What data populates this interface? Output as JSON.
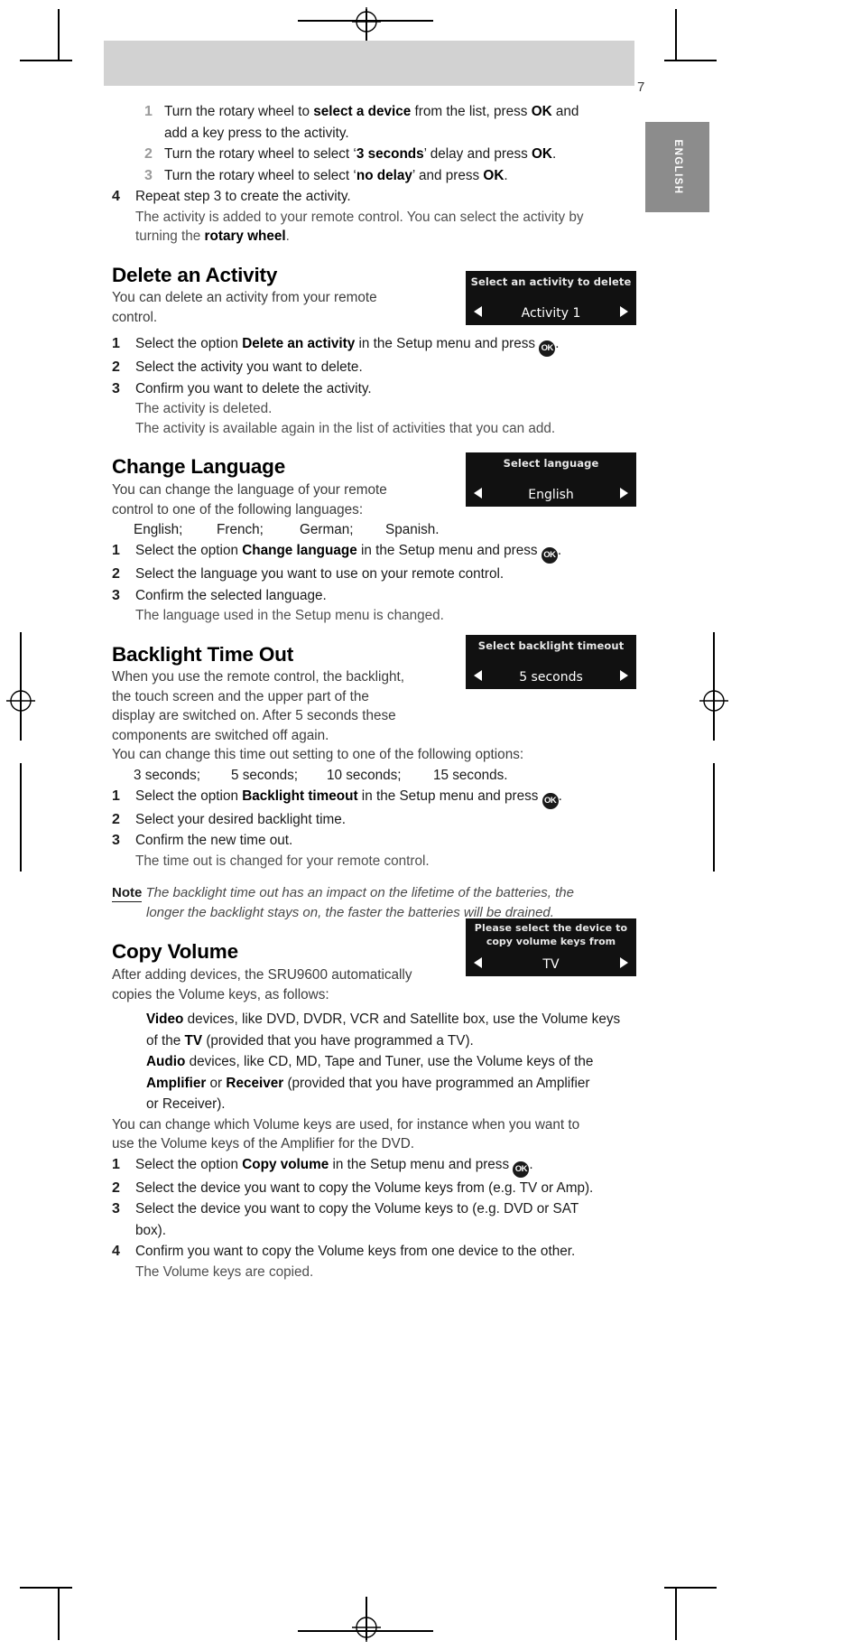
{
  "page": {
    "number": "7",
    "language_tab": "ENGLISH"
  },
  "top_steps": {
    "s1_num": "1",
    "s1_a": "Turn the rotary wheel to ",
    "s1_b": "select a device",
    "s1_c": " from the list, press ",
    "s1_d": "OK",
    "s1_e": " and",
    "s1_line2": "add a key press to the activity.",
    "s2_num": "2",
    "s2_a": "Turn the rotary wheel to select ‘",
    "s2_b": "3 seconds",
    "s2_c": "’ delay and press ",
    "s2_d": "OK",
    "s2_e": ".",
    "s3_num": "3",
    "s3_a": "Turn the rotary wheel to select ‘",
    "s3_b": "no delay",
    "s3_c": "’ and press ",
    "s3_d": "OK",
    "s3_e": ".",
    "s4_num": "4",
    "s4_text": "Repeat step 3 to create the activity.",
    "s4_sub1": "The activity is added to your remote control. You can select the activity by",
    "s4_sub2_a": "turning the ",
    "s4_sub2_b": "rotary wheel",
    "s4_sub2_c": "."
  },
  "delete_activity": {
    "heading": "Delete an Activity",
    "intro_l1": "You can delete an activity from your remote",
    "intro_l2": "control.",
    "s1_num": "1",
    "s1_a": "Select the option ",
    "s1_b": "Delete an activity",
    "s1_c": " in the Setup menu and press ",
    "s1_icon": "OK",
    "s1_d": ".",
    "s2_num": "2",
    "s2_text": "Select the activity you want to delete.",
    "s3_num": "3",
    "s3_text": "Confirm you want to delete the activity.",
    "s3_sub1": "The activity is deleted.",
    "s3_sub2": "The activity is available again in the list of activities that you can add.",
    "lcd": {
      "title": "Select an activity to delete",
      "value": "Activity 1",
      "arrow_left": "left-arrow",
      "arrow_right": "right-arrow"
    }
  },
  "change_language": {
    "heading": "Change Language",
    "intro_l1": "You can change the language of your remote",
    "intro_l2": "control to one of the following languages:",
    "options": [
      "English;",
      "French;",
      "German;",
      "Spanish."
    ],
    "s1_num": "1",
    "s1_a": "Select the option ",
    "s1_b": "Change language",
    "s1_c": " in the Setup menu and press ",
    "s1_icon": "OK",
    "s1_d": ".",
    "s2_num": "2",
    "s2_text": "Select the language you want to use on your remote control.",
    "s3_num": "3",
    "s3_text": "Confirm the selected language.",
    "s3_sub": "The language used in the Setup menu is changed.",
    "lcd": {
      "title": "Select language",
      "value": "English"
    }
  },
  "backlight": {
    "heading": "Backlight Time Out",
    "intro_l1": "When you use the remote control, the backlight,",
    "intro_l2": "the touch screen and the upper part of the",
    "intro_l3": "display are switched on. After 5 seconds these",
    "intro_l4": "components are switched off again.",
    "intro_l5": "You can change this time out setting to one of the following options:",
    "options": [
      "3 seconds;",
      "5 seconds;",
      "10 seconds;",
      "15 seconds."
    ],
    "s1_num": "1",
    "s1_a": "Select the option ",
    "s1_b": "Backlight timeout",
    "s1_c": " in the Setup menu and press ",
    "s1_icon": "OK",
    "s1_d": ".",
    "s2_num": "2",
    "s2_text": "Select your desired backlight time.",
    "s3_num": "3",
    "s3_text": "Confirm the new time out.",
    "s3_sub": "The time out is changed for your remote control.",
    "note_label": "Note",
    "note_l1": " The backlight time out has an impact on the lifetime of the batteries, the",
    "note_l2": "longer the backlight stays on, the faster the batteries will be drained.",
    "lcd": {
      "title": "Select backlight timeout",
      "value": "5 seconds"
    }
  },
  "copy_volume": {
    "heading": "Copy Volume",
    "intro_l1": "After adding devices, the SRU9600 automatically",
    "intro_l2": "copies the Volume keys, as follows:",
    "video_b": "Video",
    "video_l1": " devices, like DVD, DVDR, VCR and Satellite box, use the Volume keys",
    "video_l2_a": "of the ",
    "video_l2_b": "TV",
    "video_l2_c": " (provided that you have programmed a TV).",
    "audio_b": "Audio",
    "audio_l1": " devices, like CD, MD, Tape and Tuner, use the Volume keys of the",
    "audio_l2_a": "Amplifier",
    "audio_l2_b": " or ",
    "audio_l2_c": "Receiver",
    "audio_l2_d": " (provided that you have programmed an Amplifier",
    "audio_l3": "or Receiver).",
    "para_l1": "You can change which Volume keys are used, for instance when you want to",
    "para_l2": "use the Volume keys of the Amplifier for the DVD.",
    "s1_num": "1",
    "s1_a": "Select the option ",
    "s1_b": "Copy volume",
    "s1_c": " in the Setup menu and press ",
    "s1_icon": "OK",
    "s1_d": ".",
    "s2_num": "2",
    "s2_text": "Select the device you want to copy the Volume keys from (e.g. TV or Amp).",
    "s3_num": "3",
    "s3_l1": "Select the device you want to copy the Volume keys to (e.g. DVD or SAT",
    "s3_l2": "box).",
    "s4_num": "4",
    "s4_text": "Confirm you want to copy the Volume keys from one device to the other.",
    "s4_sub": "The Volume keys are copied.",
    "lcd": {
      "title": "Please select the device to",
      "title2": "copy volume keys from",
      "value": "TV"
    }
  },
  "colors": {
    "lcd_bg": "#111111",
    "header_grey": "#d2d2d2",
    "tab_grey": "#8c8c8c"
  }
}
